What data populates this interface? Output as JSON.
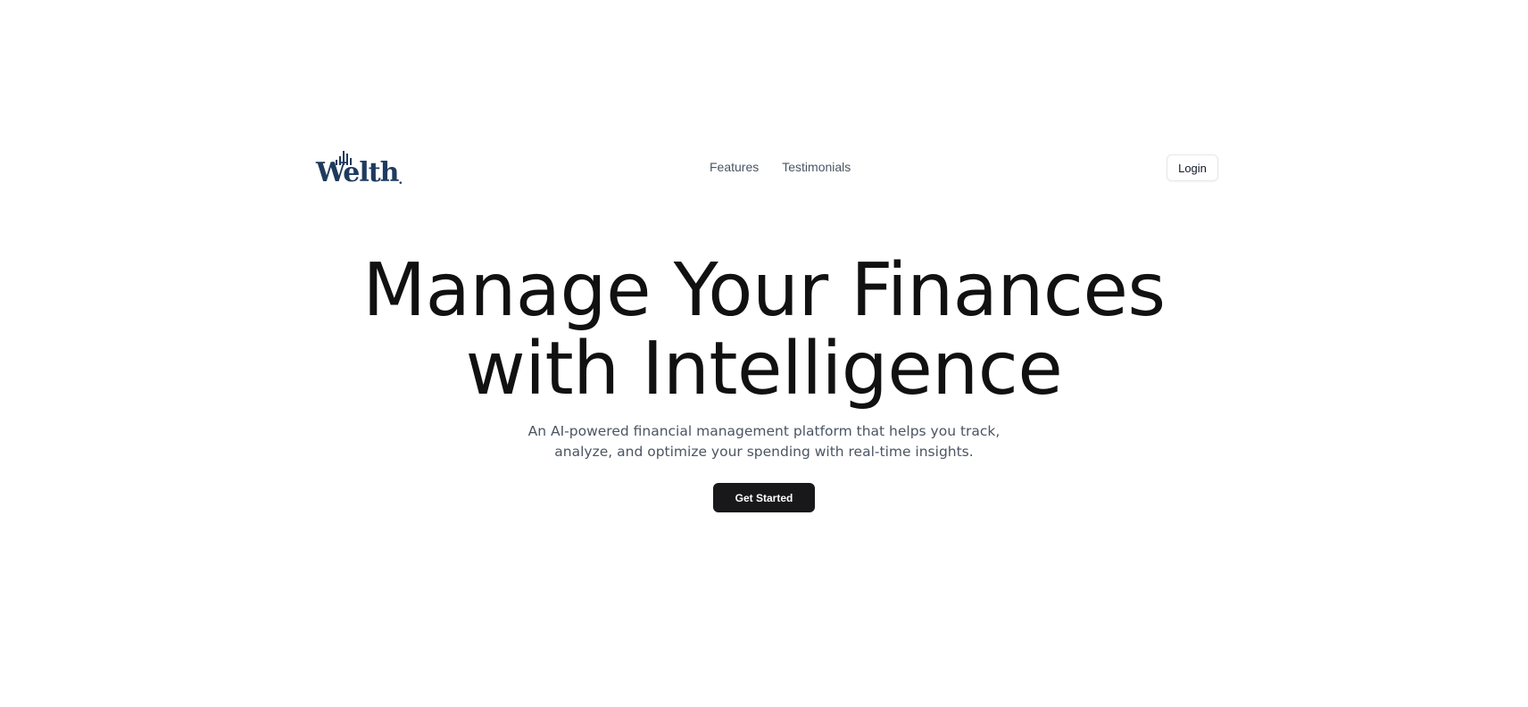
{
  "header": {
    "logo_text": "Welth",
    "logo_color": "#1f3a5f",
    "nav": [
      {
        "label": "Features"
      },
      {
        "label": "Testimonials"
      }
    ],
    "login_label": "Login"
  },
  "hero": {
    "title_line1": "Manage Your Finances",
    "title_line2": "with Intelligence",
    "subtitle": "An AI-powered financial management platform that helps you track, analyze, and optimize your spending with real-time insights.",
    "cta_label": "Get Started"
  },
  "colors": {
    "cta_background": "#18181b",
    "text_primary": "#111111",
    "text_muted": "#4b5563"
  }
}
